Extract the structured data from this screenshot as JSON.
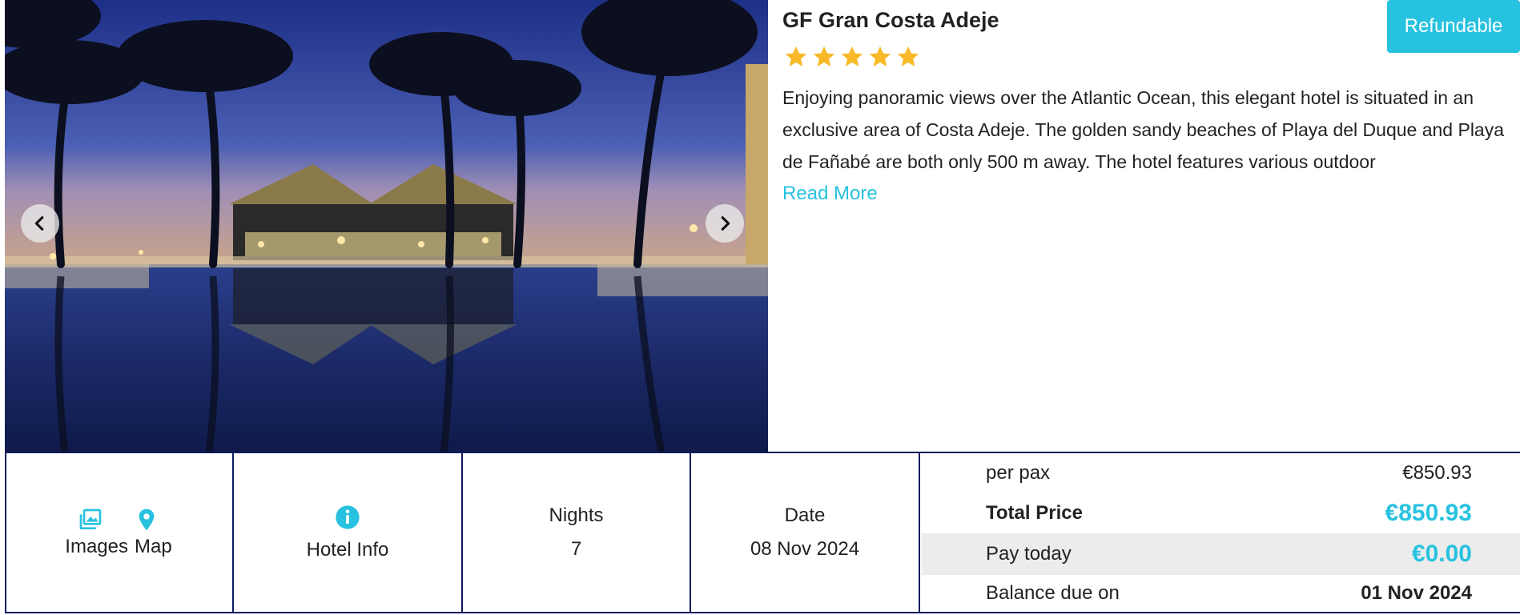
{
  "hotel": {
    "name": "GF Gran Costa Adeje",
    "badge": "Refundable",
    "rating": 5,
    "description": "Enjoying panoramic views over the Atlantic Ocean, this elegant hotel is situated in an exclusive area of Costa Adeje. The golden sandy beaches of Playa del Duque and Playa de Fañabé are both only 500 m away. The hotel features various outdoor",
    "read_more": "Read More"
  },
  "strip": {
    "images_label": "Images",
    "map_label": "Map",
    "hotel_info_label": "Hotel Info",
    "nights_label": "Nights",
    "nights_value": "7",
    "date_label": "Date",
    "date_value": "08 Nov 2024"
  },
  "pricing": {
    "per_pax_label": "per pax",
    "per_pax_value": "€850.93",
    "total_label": "Total Price",
    "total_value": "€850.93",
    "pay_today_label": "Pay today",
    "pay_today_value": "€0.00",
    "balance_label": "Balance due on",
    "balance_value": "01 Nov 2024"
  },
  "colors": {
    "accent": "#27c2e0",
    "border": "#0d1b5e",
    "star": "#f7b928"
  },
  "icons": [
    "chevron-left-icon",
    "chevron-right-icon",
    "star-icon",
    "images-icon",
    "map-pin-icon",
    "info-icon"
  ]
}
